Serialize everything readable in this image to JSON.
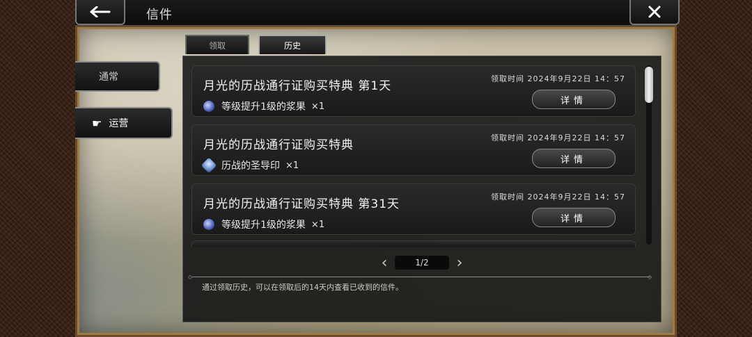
{
  "header": {
    "title": "信件"
  },
  "side_tabs": [
    {
      "label": "通常"
    },
    {
      "label": "运营"
    }
  ],
  "top_tabs": [
    {
      "label": "领取"
    },
    {
      "label": "历史"
    }
  ],
  "mails": [
    {
      "title": "月光的历战通行证购买特典  第1天",
      "time": "领取时间  2024年9月22日  14：57",
      "item": "等级提升1级的浆果",
      "qty": "×1",
      "detail": "详情"
    },
    {
      "title": "月光的历战通行证购买特典",
      "time": "领取时间  2024年9月22日  14：57",
      "item": "历战的圣导印",
      "qty": "×1",
      "detail": "详情"
    },
    {
      "title": "月光的历战通行证购买特典  第31天",
      "time": "领取时间  2024年9月22日  14：57",
      "item": "等级提升1级的浆果",
      "qty": "×1",
      "detail": "详情"
    }
  ],
  "pager": {
    "text": "1/2"
  },
  "footnote": "通过领取历史，可以在领取后的14天内查看已收到的信件。",
  "icons": {
    "back": "arrow-left-icon",
    "close": "close-icon",
    "hand": "pointing-hand-icon",
    "berry": "berry-gem-icon",
    "seal": "seal-crystal-icon"
  }
}
